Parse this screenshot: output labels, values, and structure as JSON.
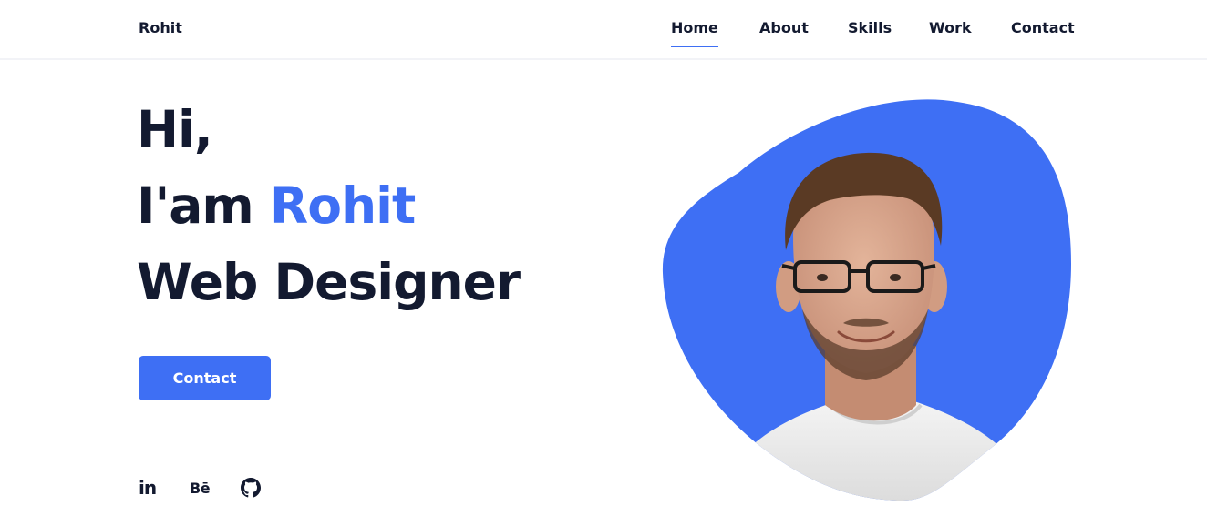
{
  "header": {
    "logo": "Rohit",
    "nav": [
      {
        "label": "Home",
        "active": true
      },
      {
        "label": "About",
        "active": false
      },
      {
        "label": "Skills",
        "active": false
      },
      {
        "label": "Work",
        "active": false
      },
      {
        "label": "Contact",
        "active": false
      }
    ]
  },
  "hero": {
    "greeting": "Hi,",
    "intro_prefix": "I'am ",
    "name": "Rohit",
    "role": "Web Designer",
    "contact_button": "Contact",
    "social": {
      "linkedin_glyph": "in",
      "behance_glyph": "Bē",
      "github_icon": "github-icon"
    },
    "blob_color": "#3e6ff4"
  },
  "colors": {
    "accent": "#3e6ff4",
    "text": "#131a30"
  }
}
